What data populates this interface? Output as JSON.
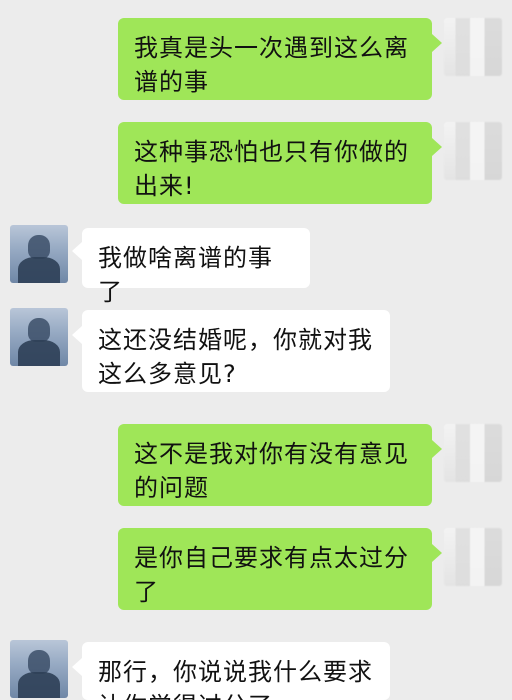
{
  "messages": [
    {
      "sender": "self",
      "text": "我真是头一次遇到这么离谱的事"
    },
    {
      "sender": "self",
      "text": "这种事恐怕也只有你做的出来!"
    },
    {
      "sender": "other",
      "text": "我做啥离谱的事了"
    },
    {
      "sender": "other",
      "text": "这还没结婚呢，你就对我这么多意见?"
    },
    {
      "sender": "self",
      "text": "这不是我对你有没有意见的问题"
    },
    {
      "sender": "self",
      "text": "是你自己要求有点太过分了"
    },
    {
      "sender": "other",
      "text": "那行，你说说我什么要求让你觉得过分了"
    }
  ],
  "colors": {
    "background": "#ececec",
    "self_bubble": "#9fe658",
    "other_bubble": "#ffffff",
    "text": "#111111"
  },
  "icons": {
    "self_avatar": "blurred-avatar",
    "other_avatar": "person-avatar"
  }
}
